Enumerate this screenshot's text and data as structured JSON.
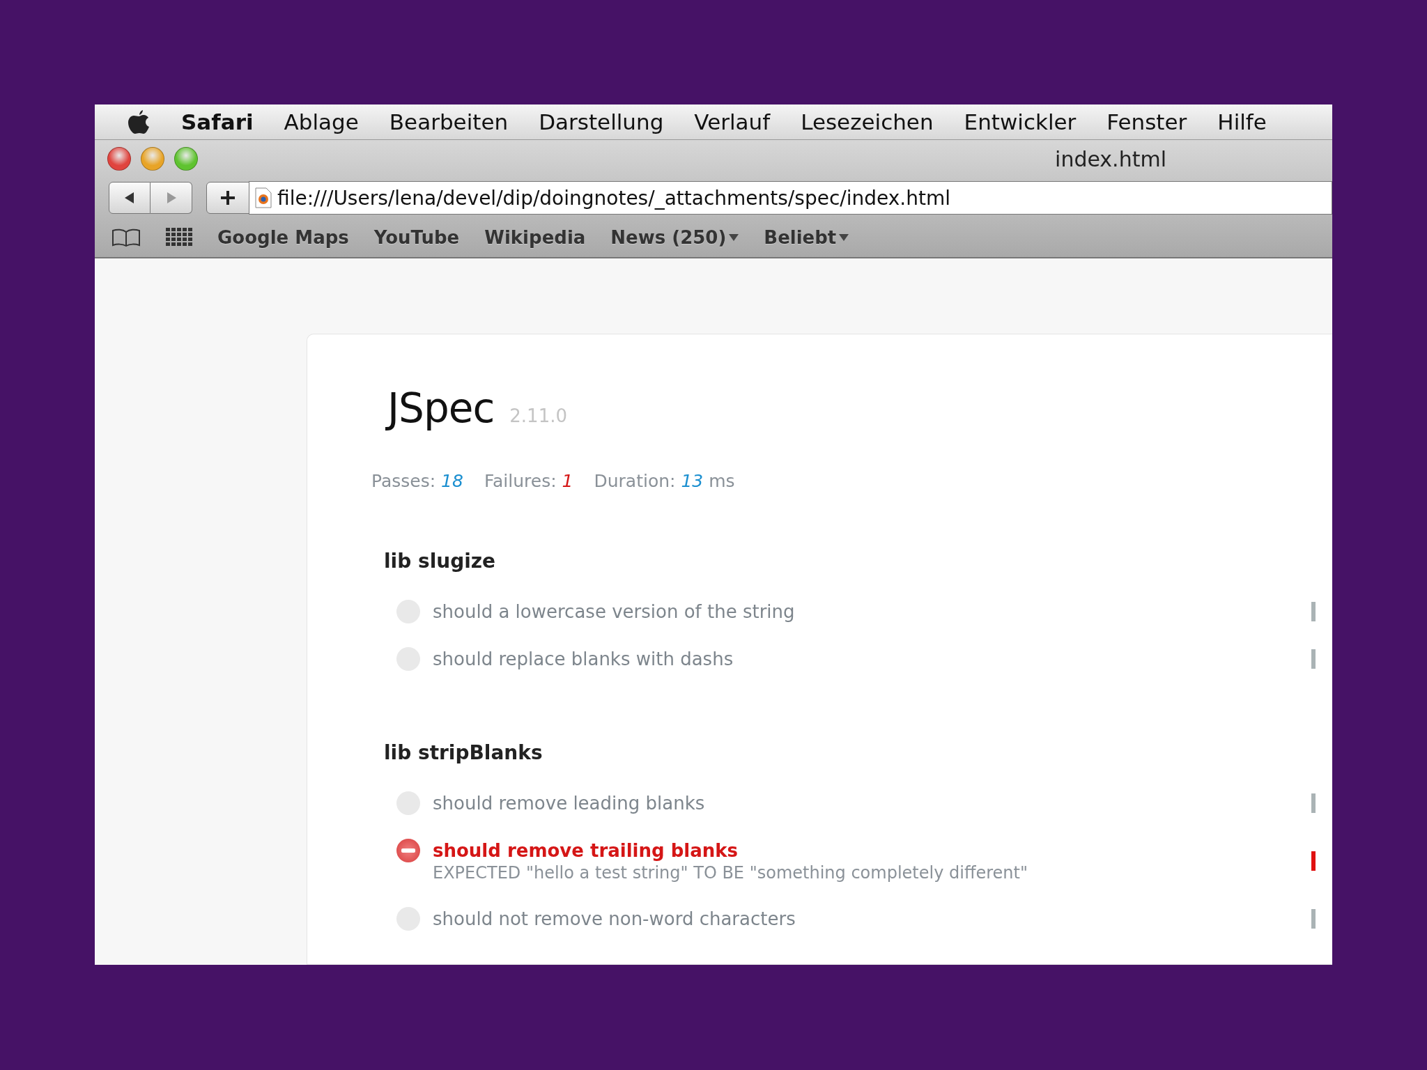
{
  "menu_bar": {
    "app": "Safari",
    "items": [
      "Ablage",
      "Bearbeiten",
      "Darstellung",
      "Verlauf",
      "Lesezeichen",
      "Entwickler",
      "Fenster",
      "Hilfe"
    ]
  },
  "window": {
    "title": "index.html"
  },
  "address_bar": {
    "value": "file:///Users/lena/devel/dip/doingnotes/_attachments/spec/index.html"
  },
  "bookmarks": [
    {
      "label": "Google Maps",
      "has_menu": false
    },
    {
      "label": "YouTube",
      "has_menu": false
    },
    {
      "label": "Wikipedia",
      "has_menu": false
    },
    {
      "label": "News (250)",
      "has_menu": true
    },
    {
      "label": "Beliebt",
      "has_menu": true
    }
  ],
  "report": {
    "title": "JSpec",
    "version": "2.11.0",
    "stats": [
      {
        "label": "Passes:",
        "value": "18",
        "kind": "pass"
      },
      {
        "label": "Failures:",
        "value": "1",
        "kind": "fail"
      },
      {
        "label": "Duration:",
        "value": "13",
        "unit": "ms",
        "kind": "pass"
      }
    ],
    "suites": [
      {
        "name": "lib slugize",
        "tests": [
          {
            "name": "should a lowercase version of the string",
            "failed": false
          },
          {
            "name": "should replace blanks with dashs",
            "failed": false
          }
        ]
      },
      {
        "name": "lib stripBlanks",
        "tests": [
          {
            "name": "should remove leading blanks",
            "failed": false
          },
          {
            "name": "should remove trailing blanks",
            "failed": true,
            "message": "EXPECTED \"hello a test string\" TO BE \"something completely different\""
          },
          {
            "name": "should not remove non-word characters",
            "failed": false
          }
        ]
      }
    ]
  }
}
